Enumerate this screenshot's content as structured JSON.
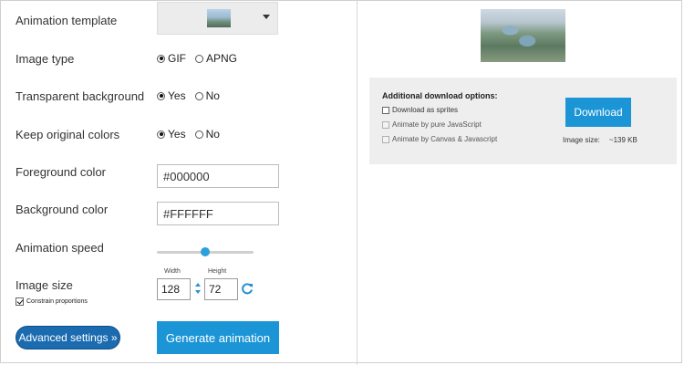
{
  "form": {
    "animation_template_label": "Animation template",
    "image_type_label": "Image type",
    "image_type_options": [
      "GIF",
      "APNG"
    ],
    "image_type_selected": "GIF",
    "transparent_bg_label": "Transparent background",
    "transparent_bg_options": [
      "Yes",
      "No"
    ],
    "transparent_bg_selected": "Yes",
    "keep_colors_label": "Keep original colors",
    "keep_colors_options": [
      "Yes",
      "No"
    ],
    "keep_colors_selected": "Yes",
    "foreground_label": "Foreground color",
    "foreground_value": "#000000",
    "background_label": "Background color",
    "background_value": "#FFFFFF",
    "speed_label": "Animation speed",
    "speed_level": 0.5,
    "image_size_label": "Image size",
    "width_label": "Width",
    "height_label": "Height",
    "width_value": "128",
    "height_value": "72",
    "constrain_label": "Constrain proportions",
    "constrain_checked": true,
    "advanced_button": "Advanced settings »",
    "generate_button": "Generate animation"
  },
  "download": {
    "title": "Additional download options:",
    "options": [
      {
        "label": "Download as sprites",
        "enabled": true,
        "checked": false
      },
      {
        "label": "Animate by pure JavaScript",
        "enabled": false,
        "checked": false
      },
      {
        "label": "Animate by Canvas & Javascript",
        "enabled": false,
        "checked": false
      }
    ],
    "button": "Download",
    "image_size_label": "Image size:",
    "image_size_value": "~139 KB"
  },
  "icons": {
    "dropdown": "chevron-down-icon",
    "link": "link-icon",
    "refresh": "refresh-icon"
  },
  "colors": {
    "accent_blue": "#1b95d6",
    "advanced_blue": "#1a6bb0",
    "slider_thumb": "#2aa0dc",
    "panel_bg": "#eeeeee"
  }
}
